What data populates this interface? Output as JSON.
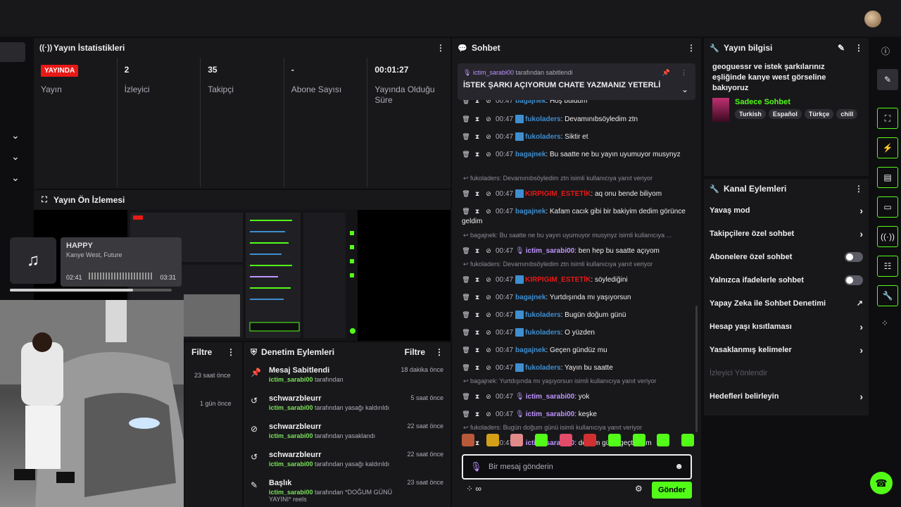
{
  "stats": {
    "title": "Yayın İstatistikleri",
    "items": [
      {
        "value": "YAYINDA",
        "label": "Yayın"
      },
      {
        "value": "2",
        "label": "İzleyici"
      },
      {
        "value": "35",
        "label": "Takipçi"
      },
      {
        "value": "-",
        "label": "Abone Sayısı"
      },
      {
        "value": "00:01:27",
        "label": "Yayında Olduğu Süre"
      }
    ]
  },
  "preview": {
    "title": "Yayın Ön İzlemesi"
  },
  "music": {
    "title": "HAPPY",
    "artist": "Kanye West, Future",
    "current": "02:41",
    "total": "03:31",
    "progress": 0.76
  },
  "filters": {
    "left": {
      "label": "Filtre",
      "times": [
        "23 saat önce",
        "1 gün önce"
      ]
    },
    "mod": {
      "title": "Denetim Eylemleri",
      "filter_label": "Filtre",
      "rows": [
        {
          "icon": "pin-icon",
          "name": "Mesaj Sabitlendi",
          "user": "ictim_sarabi00",
          "suffix": " tarafından",
          "time": "18 dakika önce"
        },
        {
          "icon": "undo-icon",
          "name": "schwarzbleurr",
          "user": "ictim_sarabi00",
          "suffix": " tarafından yasağı kaldırıldı",
          "time": "5 saat önce"
        },
        {
          "icon": "ban-icon",
          "name": "schwarzbleurr",
          "user": "ictim_sarabi00",
          "suffix": " tarafından yasaklandı",
          "time": "22 saat önce"
        },
        {
          "icon": "undo-icon",
          "name": "schwarzbleurr",
          "user": "ictim_sarabi00",
          "suffix": " tarafından yasağı kaldırıldı",
          "time": "22 saat önce"
        },
        {
          "icon": "title-icon",
          "name": "Başlık",
          "user": "ictim_sarabi00",
          "suffix": " tarafından *DOĞUM GÜNÜ YAYINI* reels",
          "time": "23 saat önce"
        }
      ]
    }
  },
  "chat": {
    "title": "Sohbet",
    "top_partial": {
      "user": "bagajnek",
      "text": "Hoş buldum"
    },
    "pinned": {
      "by_user": "ictim_sarabi00",
      "by_suffix": " tarafından sabitlendi",
      "message": "İSTEK ŞARKI AÇIYORUM CHATE YAZMANIZ YETERLİ"
    },
    "messages": [
      {
        "time": "00:47",
        "user": "fukoladers",
        "color": "#3e8ed0",
        "text": "Devamınıbsöyledim ztn",
        "badge": true
      },
      {
        "time": "00:47",
        "user": "fukoladers",
        "color": "#3e8ed0",
        "text": "Siktir et",
        "badge": true
      },
      {
        "time": "00:47",
        "user": "bagajnek",
        "color": "#3e8ed0",
        "text": "Bu saatte ne bu yayın uyumuyor musynyz",
        "badge": false
      },
      {
        "reply": "fukoladers: Devamınıbsöyledim ztn isimli kullanıcıya yanıt veriyor"
      },
      {
        "time": "00:47",
        "user": "KIRPIGIM_ESTETİK",
        "color": "#e91916",
        "text": "aq onu bende biliyom",
        "badge": true
      },
      {
        "time": "00:47",
        "user": "bagajnek",
        "color": "#3e8ed0",
        "text": "Kafam cacık gibi bir bakiyim dedim görünce geldim",
        "badge": false
      },
      {
        "reply": "bagajnek: Bu saatte ne bu yayın uyumuyor musynyz isimli kullanıcıya ..."
      },
      {
        "time": "00:47",
        "user": "ictim_sarabi00",
        "color": "#bf94ff",
        "text": "ben hep bu saatte açıyom",
        "badge": false,
        "mic": true
      },
      {
        "reply": "fukoladers: Devamınıbsöyledim ztn isimli kullanıcıya yanıt veriyor"
      },
      {
        "time": "00:47",
        "user": "KIRPIGIM_ESTETİK",
        "color": "#e91916",
        "text": "söylediğini",
        "badge": true
      },
      {
        "time": "00:47",
        "user": "bagajnek",
        "color": "#3e8ed0",
        "text": "Yurtdışında mı yaşıyorsun",
        "badge": false
      },
      {
        "time": "00:47",
        "user": "fukoladers",
        "color": "#3e8ed0",
        "text": "Bugün doğum günü",
        "badge": true
      },
      {
        "time": "00:47",
        "user": "fukoladers",
        "color": "#3e8ed0",
        "text": "O yüzden",
        "badge": true
      },
      {
        "time": "00:47",
        "user": "bagajnek",
        "color": "#3e8ed0",
        "text": "Geçen gündüz mu",
        "badge": false
      },
      {
        "time": "00:47",
        "user": "fukoladers",
        "color": "#3e8ed0",
        "text": "Yayın bu saatte",
        "badge": true
      },
      {
        "reply": "bagajnek: Yurtdışında mı yaşıyorsun isimli kullanıcıya yanıt veriyor"
      },
      {
        "time": "00:47",
        "user": "ictim_sarabi00",
        "color": "#bf94ff",
        "text": "yok",
        "badge": false,
        "mic": true
      },
      {
        "time": "00:47",
        "user": "ictim_sarabi00",
        "color": "#bf94ff",
        "text": "keşke",
        "badge": false,
        "mic": true
      },
      {
        "reply": "fukoladers: Bugün doğum günü isimli kullanıcıya yanıt veriyor"
      },
      {
        "time": "00:47",
        "user": "ictim_sarabi00",
        "color": "#bf94ff",
        "text": "doğum günü geçti olum",
        "badge": false,
        "mic": true
      }
    ],
    "emote_colors": [
      "#b85a3a",
      "#d4a017",
      "#e08a8a",
      "#53fc18",
      "#e34b6b",
      "#d03030",
      "#53fc18",
      "#53fc18",
      "#53fc18",
      "#53fc18"
    ],
    "input_placeholder": "Bir mesaj gönderin",
    "send_label": "Gönder",
    "points_label": "∞"
  },
  "info": {
    "title": "Yayın bilgisi",
    "stream_title": "geoguessr ve istek şarkılarınız eşliğinde kanye west görseline bakıyoruz",
    "category": "Sadece Sohbet",
    "tags": [
      "Turkish",
      "Español",
      "Türkçe",
      "chill"
    ]
  },
  "channel": {
    "title": "Kanal Eylemleri",
    "actions": [
      {
        "label": "Yavaş mod",
        "kind": "chevron"
      },
      {
        "label": "Takipçilere özel sohbet",
        "kind": "chevron"
      },
      {
        "label": "Abonelere özel sohbet",
        "kind": "toggle"
      },
      {
        "label": "Yalnızca ifadelerle sohbet",
        "kind": "toggle"
      },
      {
        "label": "Yapay Zeka ile Sohbet Denetimi",
        "kind": "external"
      },
      {
        "label": "Hesap yaşı kısıtlaması",
        "kind": "chevron"
      },
      {
        "label": "Yasaklanmış kelimeler",
        "kind": "chevron"
      },
      {
        "label": "İzleyici Yönlendir",
        "kind": "disabled"
      },
      {
        "label": "Hedefleri belirleyin",
        "kind": "chevron"
      }
    ]
  },
  "colors": {
    "accent": "#53fc18",
    "live": "#e91916",
    "mod": "#bf94ff"
  }
}
